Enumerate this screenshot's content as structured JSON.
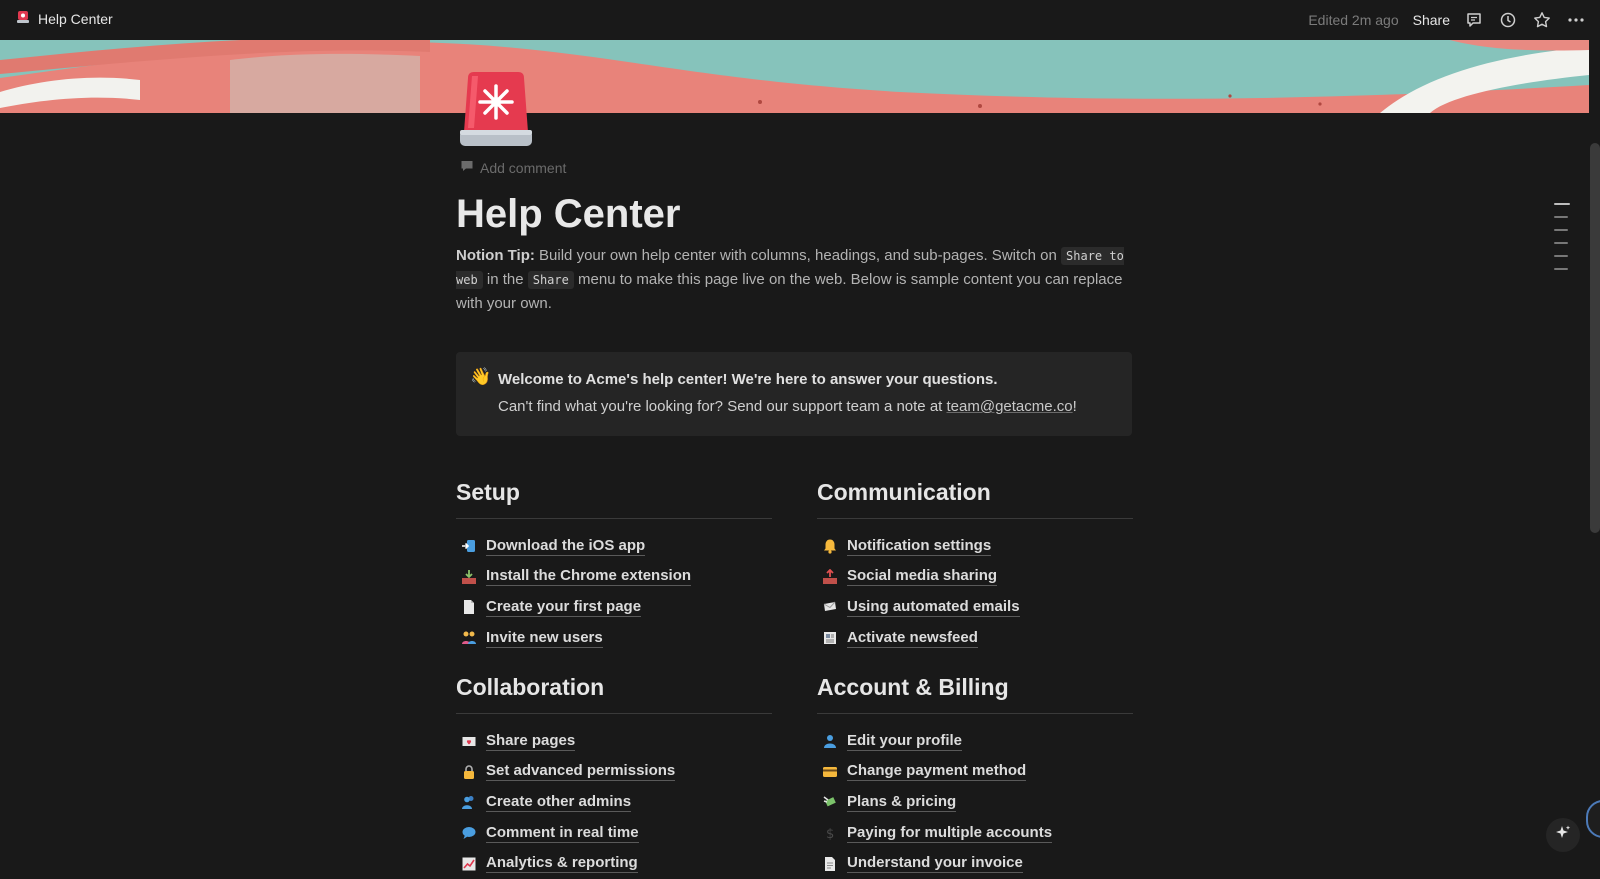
{
  "topbar": {
    "breadcrumb": "Help Center",
    "edited": "Edited 2m ago",
    "share": "Share",
    "icons": [
      "comments-icon",
      "history-icon",
      "favorite-star-icon",
      "more-icon"
    ]
  },
  "page": {
    "icon": "siren-icon",
    "add_comment": "Add comment",
    "title": "Help Center",
    "tip": {
      "bold": "Notion Tip:",
      "t1": " Build your own help center with columns, headings, and sub-pages. Switch on ",
      "code1": "Share to web",
      "t2": " in the ",
      "code2": "Share",
      "t3": " menu to make this page live on the web. Below is sample content you can replace with your own."
    },
    "callout": {
      "icon": "waving-hand-icon",
      "line1": "Welcome to Acme's help center! We're here to answer your questions.",
      "line2_prefix": "Can't find what you're looking for? Send our support team a note at ",
      "email": "team@getacme.co",
      "line2_suffix": "!"
    }
  },
  "sections": [
    {
      "title": "Setup",
      "items": [
        {
          "label": "Download the iOS app",
          "icon": "mobile-arrow-icon"
        },
        {
          "label": "Install the Chrome extension",
          "icon": "inbox-tray-icon"
        },
        {
          "label": "Create your first page",
          "icon": "page-icon"
        },
        {
          "label": "Invite new users",
          "icon": "people-icon"
        }
      ]
    },
    {
      "title": "Communication",
      "items": [
        {
          "label": "Notification settings",
          "icon": "bell-icon"
        },
        {
          "label": "Social media sharing",
          "icon": "outbox-tray-icon"
        },
        {
          "label": "Using automated emails",
          "icon": "envelope-icon"
        },
        {
          "label": "Activate newsfeed",
          "icon": "newspaper-icon"
        }
      ]
    },
    {
      "title": "Collaboration",
      "items": [
        {
          "label": "Share pages",
          "icon": "love-letter-icon"
        },
        {
          "label": "Set advanced permissions",
          "icon": "lock-icon"
        },
        {
          "label": "Create other admins",
          "icon": "users-icon"
        },
        {
          "label": "Comment in real time",
          "icon": "speech-bubble-icon"
        },
        {
          "label": "Analytics & reporting",
          "icon": "chart-up-icon"
        }
      ]
    },
    {
      "title": "Account & Billing",
      "items": [
        {
          "label": "Edit your profile",
          "icon": "user-icon"
        },
        {
          "label": "Change payment method",
          "icon": "credit-card-icon"
        },
        {
          "label": "Plans & pricing",
          "icon": "money-wings-icon"
        },
        {
          "label": "Paying for multiple accounts",
          "icon": "dollar-icon"
        },
        {
          "label": "Understand your invoice",
          "icon": "document-icon"
        }
      ]
    }
  ],
  "colors": {
    "background": "#191919",
    "text": "#dcdcdc",
    "accent_red": "#e0384f"
  }
}
